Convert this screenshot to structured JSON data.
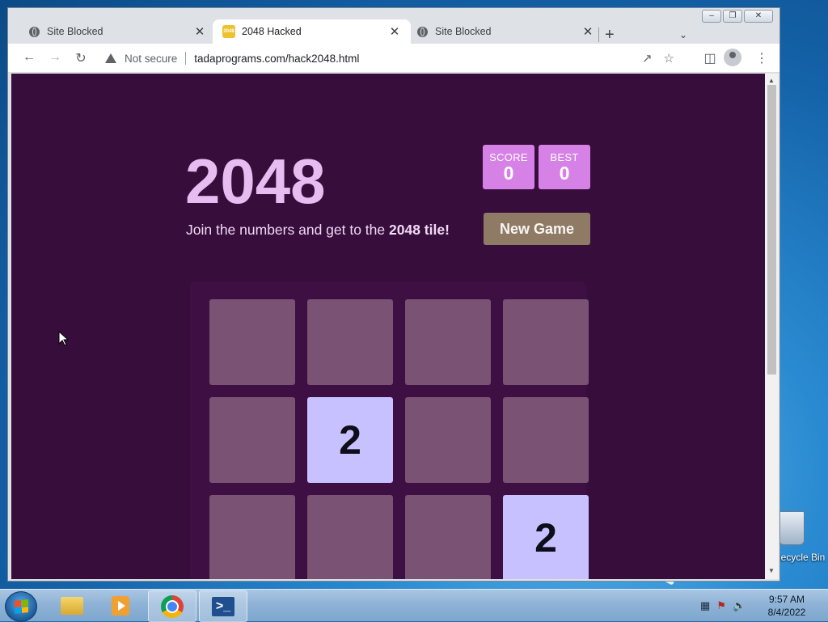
{
  "browser": {
    "tabs": [
      {
        "title": "Site Blocked",
        "icon": "globe-icon",
        "active": false
      },
      {
        "title": "2048 Hacked",
        "icon": "2048-favicon",
        "active": true
      },
      {
        "title": "Site Blocked",
        "icon": "globe-icon",
        "active": false
      }
    ],
    "security_label": "Not secure",
    "url": "tadaprograms.com/hack2048.html"
  },
  "game": {
    "title": "2048",
    "score_label": "SCORE",
    "score_value": "0",
    "best_label": "BEST",
    "best_value": "0",
    "intro_text": "Join the numbers and get to the ",
    "intro_bold": "2048 tile!",
    "new_game_label": "New Game",
    "grid": [
      [
        "",
        "",
        "",
        ""
      ],
      [
        "",
        "2",
        "",
        ""
      ],
      [
        "",
        "",
        "",
        "2"
      ]
    ],
    "colors": {
      "background": "#370e3b",
      "title": "#e6bcf1",
      "score_box": "#d681e6",
      "empty_cell": "#7a5273",
      "tile_2": "#c7c1ff",
      "button": "#8f7a66"
    }
  },
  "desktop": {
    "recycle_bin_label": "Recycle Bin"
  },
  "taskbar": {
    "time": "9:57 AM",
    "date": "8/4/2022"
  }
}
